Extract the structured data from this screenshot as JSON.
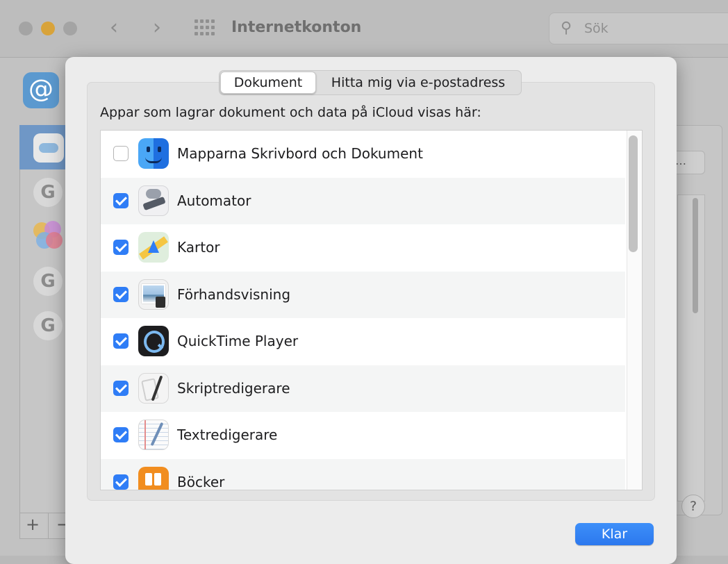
{
  "window": {
    "title": "Internetkonton",
    "search_placeholder": "Sök",
    "side_button_label": "…",
    "help_label": "?",
    "add_label": "+",
    "remove_label": "−"
  },
  "sheet": {
    "tabs": [
      {
        "label": "Dokument",
        "selected": true
      },
      {
        "label": "Hitta mig via e-postadress",
        "selected": false
      }
    ],
    "description": "Appar som lagrar dokument och data på iCloud visas här:",
    "apps": [
      {
        "label": "Mapparna Skrivbord och Dokument",
        "checked": false,
        "icon": "finder-icon"
      },
      {
        "label": "Automator",
        "checked": true,
        "icon": "automator-icon"
      },
      {
        "label": "Kartor",
        "checked": true,
        "icon": "maps-icon"
      },
      {
        "label": "Förhandsvisning",
        "checked": true,
        "icon": "preview-icon"
      },
      {
        "label": "QuickTime Player",
        "checked": true,
        "icon": "quicktime-icon"
      },
      {
        "label": "Skriptredigerare",
        "checked": true,
        "icon": "script-editor-icon"
      },
      {
        "label": "Textredigerare",
        "checked": true,
        "icon": "textedit-icon"
      },
      {
        "label": "Böcker",
        "checked": true,
        "icon": "books-icon"
      }
    ],
    "done_label": "Klar"
  },
  "colors": {
    "accent": "#2f7df6",
    "done_button": "#3385f8"
  }
}
